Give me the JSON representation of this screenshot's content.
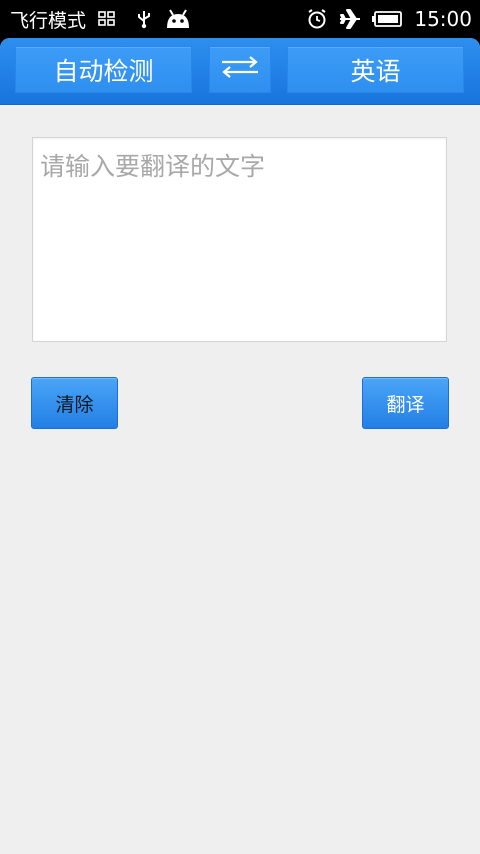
{
  "status_bar": {
    "mode_text": "飞行模式",
    "time": "15:00",
    "icons": [
      "notification-grid-icon",
      "usb-icon",
      "android-icon",
      "alarm-icon",
      "airplane-icon",
      "battery-icon"
    ]
  },
  "toolbar": {
    "source_language": "自动检测",
    "swap_icon": "swap-arrows-icon",
    "target_language": "英语"
  },
  "input": {
    "placeholder": "请输入要翻译的文字",
    "value": ""
  },
  "actions": {
    "clear_label": "清除",
    "translate_label": "翻译"
  },
  "colors": {
    "toolbar": "#1f7fe4",
    "button": "#2f8ff0",
    "background": "#efefef"
  }
}
